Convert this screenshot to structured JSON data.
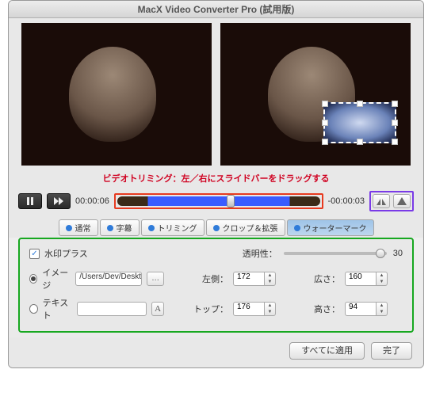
{
  "window": {
    "title": "MacX Video Converter Pro (試用版)"
  },
  "caption": "ビデオトリミング：左／右にスライドバーをドラッグする",
  "transport": {
    "pause_icon": "pause-icon",
    "ff_icon": "fast-forward-icon",
    "time_current": "00:00:06",
    "time_remaining": "-00:00:03",
    "flip_h_icon": "flip-horizontal-icon",
    "flip_v_icon": "flip-vertical-icon"
  },
  "tabs": {
    "normal": "通常",
    "subtitle": "字幕",
    "trimming": "トリミング",
    "crop": "クロップ＆拡張",
    "watermark": "ウォーターマーク"
  },
  "panel": {
    "watermark_plus": "水印プラス",
    "watermark_checked": true,
    "opacity_label": "透明性：",
    "opacity_value": "30",
    "image_label": "イメージ",
    "image_path": "/Users/Dev/Desktop/TES",
    "browse_label": "…",
    "text_label": "テキスト",
    "text_value": "",
    "font_btn": "A",
    "left_label": "左側：",
    "left_value": "172",
    "top_label": "トップ：",
    "top_value": "176",
    "width_label": "広さ：",
    "width_value": "160",
    "height_label": "高さ：",
    "height_value": "94"
  },
  "footer": {
    "apply_all": "すべてに適用",
    "done": "完了"
  },
  "colors": {
    "highlight_red": "#e73a1f",
    "highlight_green": "#17a820",
    "highlight_purple": "#7a3be7",
    "accent_blue": "#2f7bd9"
  }
}
